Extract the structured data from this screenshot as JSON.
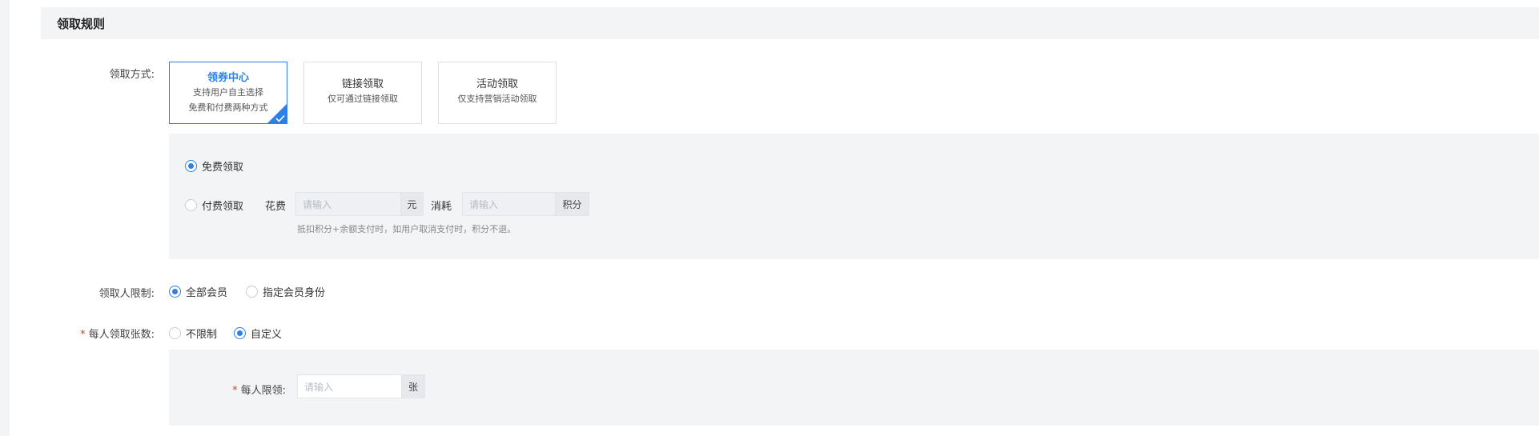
{
  "section": {
    "title": "领取规则"
  },
  "claim_method": {
    "label": "领取方式:",
    "cards": [
      {
        "title": "领券中心",
        "desc1": "支持用户自主选择",
        "desc2": "免费和付费两种方式",
        "selected": true
      },
      {
        "title": "链接领取",
        "desc1": "仅可通过链接领取",
        "desc2": "",
        "selected": false
      },
      {
        "title": "活动领取",
        "desc1": "仅支持营销活动领取",
        "desc2": "",
        "selected": false
      }
    ],
    "options": {
      "free_label": "免费领取",
      "paid_label": "付费领取",
      "cost_label": "花费",
      "cost_placeholder": "请输入",
      "cost_unit": "元",
      "points_label": "消耗",
      "points_placeholder": "请输入",
      "points_unit": "积分",
      "hint": "抵扣积分+余额支付时，如用户取消支付时，积分不退。"
    }
  },
  "recipient_limit": {
    "label": "领取人限制:",
    "option_all": "全部会员",
    "option_specific": "指定会员身份"
  },
  "per_person": {
    "label": "每人领取张数:",
    "required_mark": "*",
    "option_unlimited": "不限制",
    "option_custom": "自定义",
    "limit_label": "每人限领:",
    "limit_placeholder": "请输入",
    "limit_unit": "张"
  },
  "colors": {
    "accent": "#2e7fe6",
    "required": "#e5342f",
    "panel_bg": "#f3f4f6"
  }
}
